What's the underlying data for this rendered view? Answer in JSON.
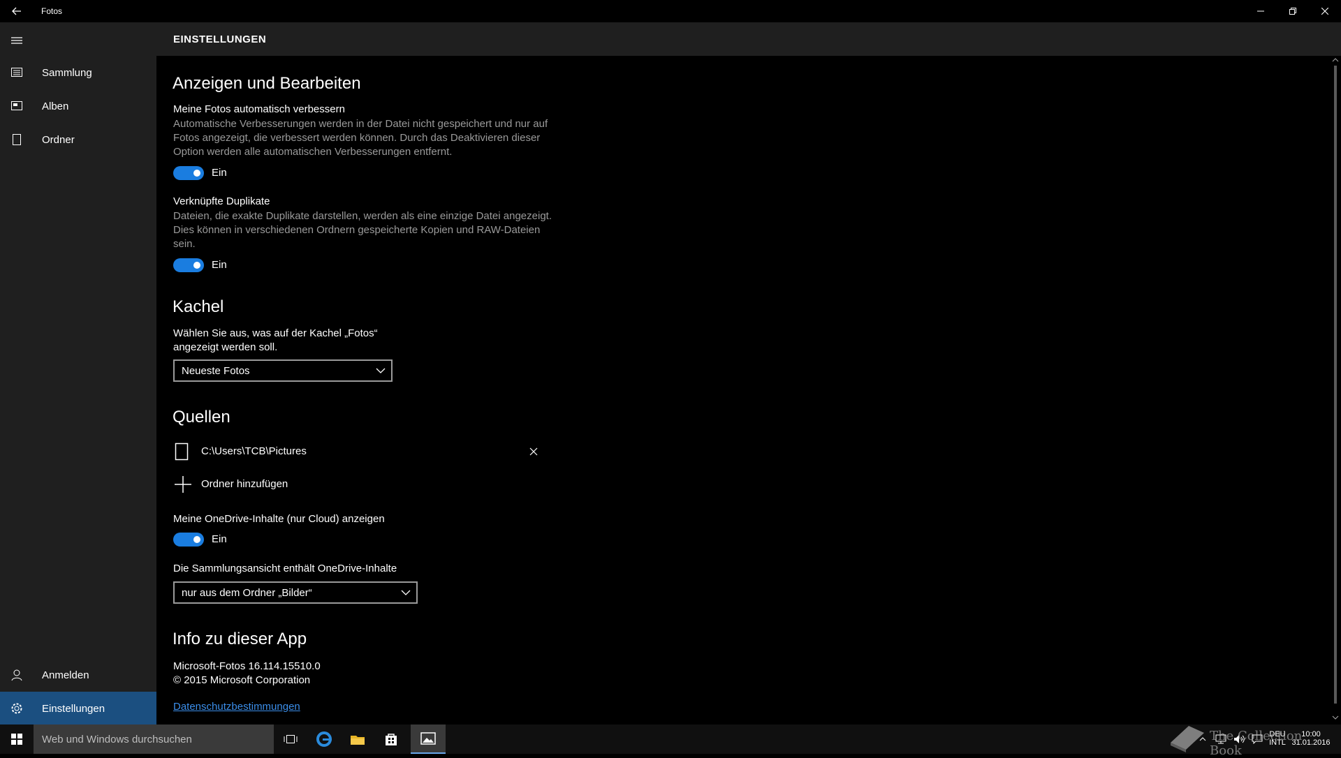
{
  "window": {
    "title": "Fotos"
  },
  "sidebar": {
    "items": [
      {
        "label": "Sammlung"
      },
      {
        "label": "Alben"
      },
      {
        "label": "Ordner"
      }
    ],
    "bottom_items": [
      {
        "label": "Anmelden"
      },
      {
        "label": "Einstellungen"
      }
    ]
  },
  "header": {
    "title": "EINSTELLUNGEN"
  },
  "settings": {
    "view_edit": {
      "title": "Anzeigen und Bearbeiten",
      "auto_enhance": {
        "label": "Meine Fotos automatisch verbessern",
        "description": "Automatische Verbesserungen werden in der Datei nicht gespeichert und nur auf Fotos angezeigt, die verbessert werden können. Durch das Deaktivieren dieser Option werden alle automatischen Verbesserungen entfernt.",
        "toggle_label": "Ein",
        "on": true
      },
      "duplicates": {
        "label": "Verknüpfte Duplikate",
        "description": "Dateien, die exakte Duplikate darstellen, werden als eine einzige Datei angezeigt. Dies können in verschiedenen Ordnern gespeicherte Kopien und RAW-Dateien sein.",
        "toggle_label": "Ein",
        "on": true
      }
    },
    "tile": {
      "title": "Kachel",
      "label": "Wählen Sie aus, was auf der Kachel „Fotos“ angezeigt werden soll.",
      "selected": "Neueste Fotos"
    },
    "sources": {
      "title": "Quellen",
      "folders": [
        "C:\\Users\\TCB\\Pictures"
      ],
      "add_label": "Ordner hinzufügen",
      "onedrive": {
        "label": "Meine OneDrive-Inhalte (nur Cloud) anzeigen",
        "toggle_label": "Ein",
        "on": true
      },
      "collection": {
        "label": "Die Sammlungsansicht enthält OneDrive-Inhalte",
        "selected": "nur aus dem Ordner „Bilder“"
      }
    },
    "about": {
      "title": "Info zu dieser App",
      "version": "Microsoft-Fotos 16.114.15510.0",
      "copyright": "© 2015 Microsoft Corporation",
      "privacy_link": "Datenschutzbestimmungen"
    }
  },
  "taskbar": {
    "search_placeholder": "Web und Windows durchsuchen",
    "lang_top": "DEU",
    "lang_bottom": "INTL",
    "time": "10:00",
    "date": "31.01.2016"
  },
  "watermark": {
    "text": "The Collection Book"
  },
  "colors": {
    "accent": "#1a7de0",
    "active_nav": "#1b4f80",
    "link": "#3b8eea"
  }
}
